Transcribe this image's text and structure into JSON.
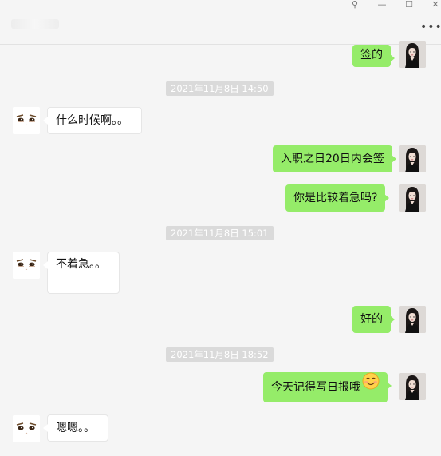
{
  "window": {
    "controls": [
      {
        "name": "pin-icon",
        "glyph": "⚲"
      },
      {
        "name": "minimize-icon",
        "glyph": "—"
      },
      {
        "name": "maximize-icon",
        "glyph": "☐"
      },
      {
        "name": "close-icon",
        "glyph": "✕"
      }
    ],
    "more_glyph": "•••"
  },
  "messages": [
    {
      "kind": "msg",
      "from": "me",
      "text": "签的"
    },
    {
      "kind": "time",
      "text": "2021年11月8日 14:50"
    },
    {
      "kind": "msg",
      "from": "other",
      "text": "什么时候啊。。"
    },
    {
      "kind": "msg",
      "from": "me",
      "text": "入职之日20日内会签"
    },
    {
      "kind": "msg",
      "from": "me",
      "text": "你是比较着急吗?"
    },
    {
      "kind": "time",
      "text": "2021年11月8日 15:01"
    },
    {
      "kind": "msg",
      "from": "other",
      "text": "不着急。。"
    },
    {
      "kind": "msg",
      "from": "me",
      "text": "好的"
    },
    {
      "kind": "time",
      "text": "2021年11月8日 18:52"
    },
    {
      "kind": "msg",
      "from": "me",
      "text": "今天记得写日报哦",
      "emoji": "smiling-face-emoji"
    },
    {
      "kind": "msg",
      "from": "other",
      "text": "嗯嗯。。"
    }
  ],
  "colors": {
    "my_bubble": "#95ec69",
    "other_bubble": "#ffffff",
    "background": "#f5f5f5",
    "timestamp_bg": "#dadada"
  }
}
